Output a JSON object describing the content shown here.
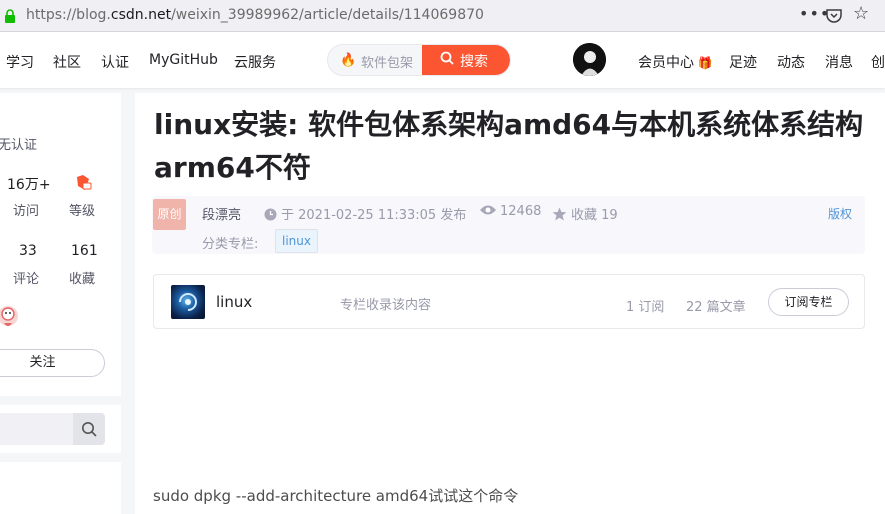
{
  "browser": {
    "url_prefix": "https://blog.",
    "url_domain": "csdn.net",
    "url_path": "/weixin_39989962/article/details/114069870",
    "more_icon": "ellipsis-icon",
    "pocket_icon": "pocket-icon",
    "bookmark_icon": "star-icon"
  },
  "topnav": {
    "links": [
      "学习",
      "社区",
      "认证",
      "MyGitHub",
      "云服务"
    ],
    "search_placeholder": "软件包架",
    "search_button": "搜索",
    "right_links": [
      "会员中心",
      "足迹",
      "动态",
      "消息",
      "创"
    ]
  },
  "sidebar": {
    "cert": "无认证",
    "visits_value": "16万+",
    "visits_label": "访问",
    "level_label": "等级",
    "comments_value": "33",
    "comments_label": "评论",
    "favorites_value": "161",
    "favorites_label": "收藏",
    "follow_button": "关注"
  },
  "article": {
    "title": "linux安装: 软件包体系架构amd64与本机系统体系结构arm64不符",
    "origin_badge": "原创",
    "author": "段漂亮",
    "publish_time": "于 2021-02-25 11:33:05 发布",
    "views": "12468",
    "collect": "收藏 19",
    "copyright": "版权",
    "category_label": "分类专栏:",
    "category_tag": "linux",
    "column": {
      "name": "linux",
      "label": "专栏收录该内容",
      "subscriptions": "1 订阅",
      "articles": "22 篇文章",
      "subscribe_button": "订阅专栏"
    },
    "body_first_line": "sudo dpkg --add-architecture amd64试试这个命令"
  },
  "colors": {
    "accent": "#fc5531",
    "link_blue": "#5094d5",
    "origin_badge_bg": "#f0b4ab"
  }
}
